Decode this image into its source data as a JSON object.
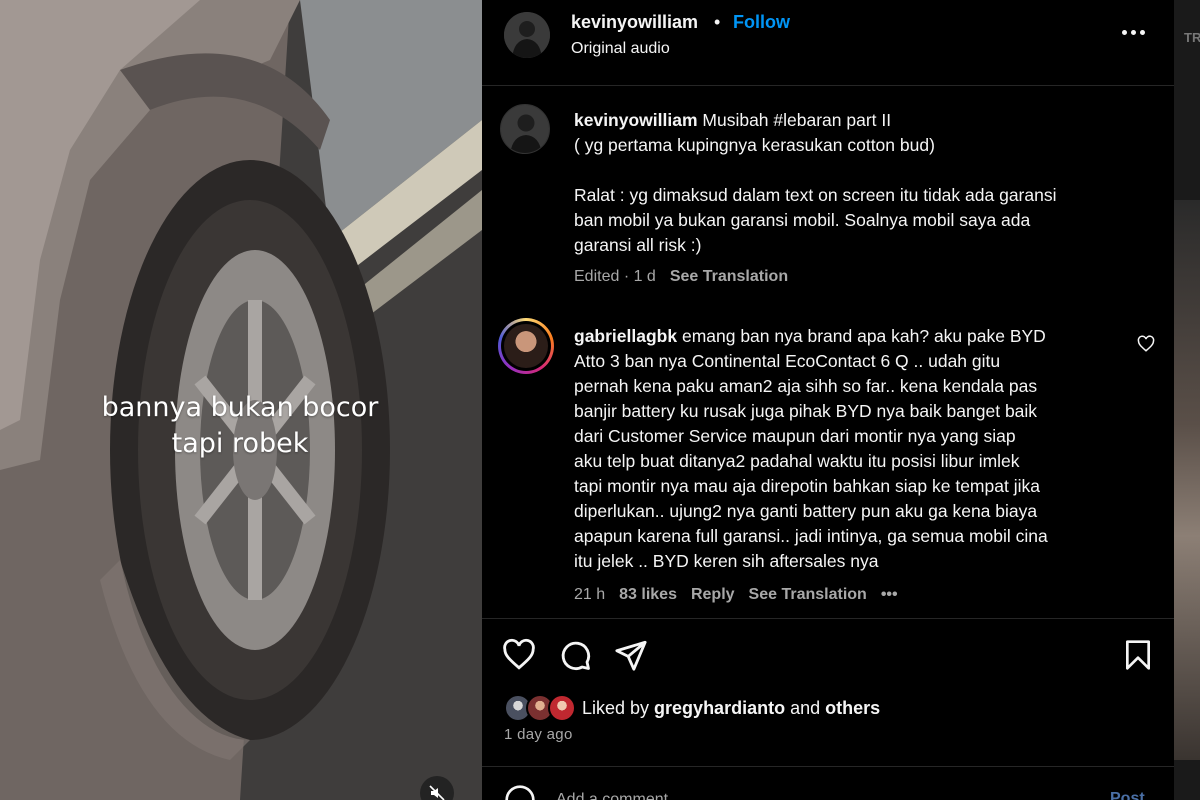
{
  "media": {
    "overlay_line1": "bannya bukan bocor",
    "overlay_line2": "tapi robek",
    "mute_icon": "speaker-muted-icon"
  },
  "header": {
    "username": "kevinyowilliam",
    "separator": "•",
    "follow_label": "Follow",
    "audio_label": "Original audio",
    "more_icon": "more-horizontal-icon"
  },
  "edge": {
    "text": "TR"
  },
  "caption": {
    "username": "kevinyowilliam",
    "text_part1": " Musibah #lebaran part II\n( yg pertama kupingnya kerasukan cotton bud)\n\nRalat : yg dimaksud dalam text on screen itu tidak ada garansi\nban mobil ya bukan garansi mobil. Soalnya mobil saya ada\ngaransi all risk :)",
    "edited": "Edited · 1 d",
    "see_translation": "See Translation"
  },
  "comment": {
    "username": "gabriellagbk",
    "text": " emang ban nya brand apa kah? aku pake BYD\nAtto 3 ban nya Continental EcoContact 6 Q .. udah gitu\npernah kena paku aman2 aja sihh so far.. kena kendala pas\nbanjir battery ku rusak juga pihak BYD nya baik banget baik\ndari Customer Service maupun dari montir nya yang siap\naku telp buat ditanya2 padahal waktu itu posisi libur imlek\ntapi montir nya mau aja direpotin bahkan siap ke tempat jika\ndiperlukan.. ujung2 nya ganti battery pun aku ga kena biaya\napapun karena full garansi.. jadi intinya, ga semua mobil cina\nitu jelek .. BYD keren sih aftersales nya",
    "time": "21 h",
    "likes": "83 likes",
    "reply": "Reply",
    "see_translation": "See Translation",
    "more": "•••",
    "heart_icon": "heart-outline-icon"
  },
  "actions": {
    "like_icon": "heart-icon",
    "comment_icon": "comment-icon",
    "share_icon": "send-icon",
    "save_icon": "bookmark-icon"
  },
  "likes": {
    "prefix": "Liked by ",
    "user": "gregyhardianto",
    "middle": " and ",
    "others": "others"
  },
  "time_ago": "1 day ago",
  "add_comment": {
    "placeholder": "Add a comment…",
    "post_label": "Post",
    "emoji_icon": "emoji-icon"
  }
}
